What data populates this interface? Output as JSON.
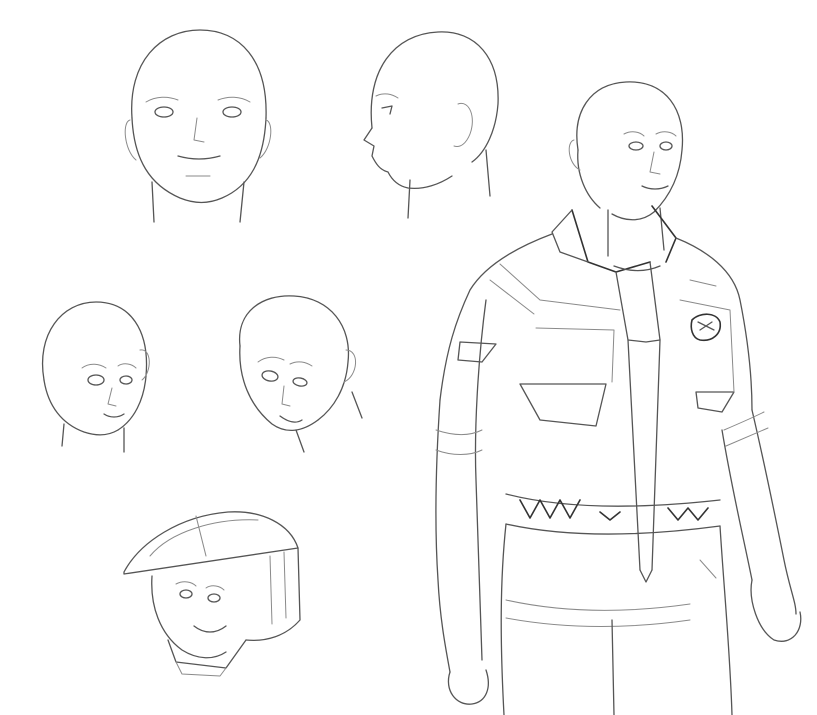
{
  "sketch": {
    "paper_color": "#ffffff",
    "line_color": "#555555",
    "subjects": [
      "head-front",
      "head-profile",
      "head-three-quarter-left",
      "head-three-quarter-tilted",
      "helmeted-head",
      "figure-in-flight-suit"
    ]
  }
}
